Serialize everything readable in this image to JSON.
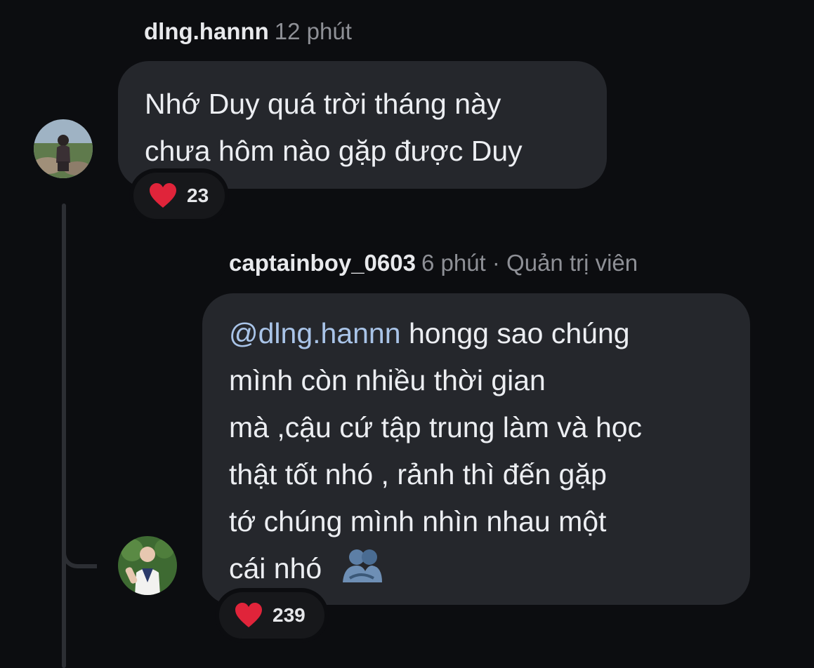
{
  "comment1": {
    "username": "dlng.hannn",
    "time": "12 phút",
    "lines": [
      "Nhớ Duy quá trời tháng này",
      "chưa hôm nào gặp được Duy"
    ],
    "reaction_count": "23"
  },
  "reply1": {
    "username": "captainboy_0603",
    "time": "6 phút",
    "role": "· Quản trị viên",
    "mention": "@dlng.hannn",
    "line1_rest": " hongg sao chúng",
    "lines": [
      "mình còn nhiều thời gian",
      "mà ,cậu cứ tập trung làm và học",
      "thật tốt nhó , rảnh thì đến gặp",
      "tớ chúng mình nhìn nhau một"
    ],
    "last_line": "cái nhó",
    "emoji": "people-hugging-emoji",
    "reaction_count": "239"
  },
  "colors": {
    "background": "#0c0d10",
    "bubble": "#25272c",
    "mention": "#a9c4e8",
    "muted": "#8e9096",
    "heart": "#e0243a"
  }
}
